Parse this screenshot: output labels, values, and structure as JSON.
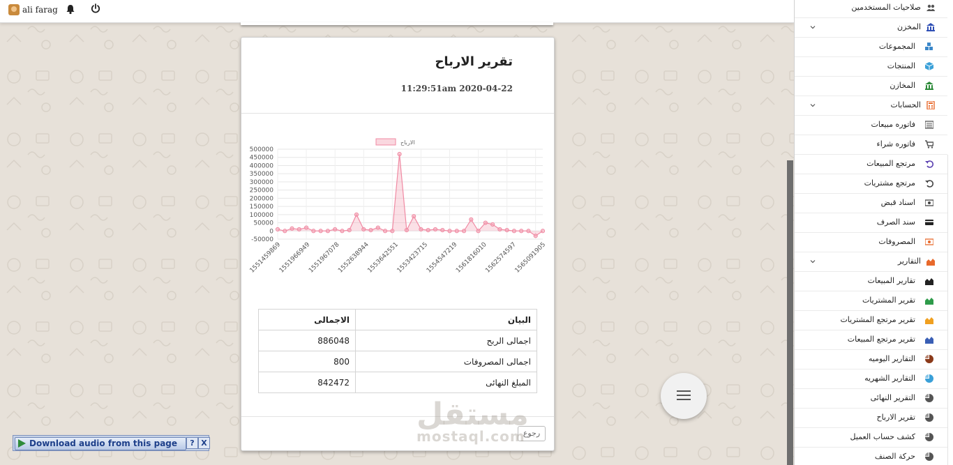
{
  "topbar": {
    "user_name": "ali farag",
    "icons": [
      "avatar-icon",
      "bell-icon",
      "power-icon"
    ]
  },
  "report": {
    "title": "تقرير الارباح",
    "datetime": "11:29:51am 2020-04-22",
    "back_label": "رجوع"
  },
  "chart_data": {
    "type": "area",
    "legend": [
      "الارباح"
    ],
    "series": [
      {
        "name": "الارباح",
        "color": "#f4a6b8",
        "values": [
          10000,
          0,
          15000,
          10000,
          20000,
          0,
          0,
          0,
          10000,
          0,
          5000,
          100000,
          10000,
          5000,
          20000,
          0,
          0,
          470000,
          5000,
          90000,
          10000,
          5000,
          10000,
          5000,
          0,
          0,
          0,
          70000,
          0,
          50000,
          40000,
          10000,
          5000,
          0,
          0,
          0,
          -30000,
          0
        ]
      }
    ],
    "x_tick_labels": [
      "1551459869",
      "1551966949",
      "1551967078",
      "1552638944",
      "1553642551",
      "1553423715",
      "1554547219",
      "1561816010",
      "1562574597",
      "1565091905"
    ],
    "ylim": [
      -50000,
      500000
    ],
    "y_ticks": [
      500000,
      450000,
      400000,
      350000,
      300000,
      250000,
      200000,
      150000,
      100000,
      50000,
      0,
      -50000
    ],
    "grid": true,
    "legend_position": "top"
  },
  "summary": {
    "headers": {
      "label": "البيان",
      "value": "الاجمالى"
    },
    "rows": [
      {
        "label": "اجمالى الربح",
        "value": "886048"
      },
      {
        "label": "اجمالى المصروفات",
        "value": "800"
      },
      {
        "label": "المبلغ النهائى",
        "value": "842472"
      }
    ]
  },
  "watermark": {
    "ar": "مستقل",
    "en": "mostaql.com"
  },
  "sidebar": {
    "items": [
      {
        "label": "صلاحيات المستخدمين",
        "icon": "users-icon",
        "color": "#555"
      },
      {
        "label": "المخزن",
        "icon": "bank-icon",
        "color": "#2f4fb5",
        "expandable": true
      },
      {
        "label": "المجموعات",
        "icon": "cubes-icon",
        "color": "#3a87c9",
        "sub": true
      },
      {
        "label": "المنتجات",
        "icon": "cube-icon",
        "color": "#3aa0d8",
        "sub": true
      },
      {
        "label": "المخازن",
        "icon": "warehouse-icon",
        "color": "#2e8b3a",
        "sub": true
      },
      {
        "label": "الحسابات",
        "icon": "calculator-icon",
        "color": "#e8692b",
        "expandable": true
      },
      {
        "label": "فاتوره مبيعات",
        "icon": "list-alt-icon",
        "color": "#555",
        "sub": true
      },
      {
        "label": "فاتوره شراء",
        "icon": "cart-icon",
        "color": "#555",
        "sub": true
      },
      {
        "label": "مرتجع المبيعات",
        "icon": "undo-icon",
        "color": "#5a3fb0",
        "sub": true
      },
      {
        "label": "مرتجع مشتريات",
        "icon": "undo-icon",
        "color": "#444",
        "sub": true
      },
      {
        "label": "اسناد قبض",
        "icon": "money-icon",
        "color": "#444",
        "sub": true
      },
      {
        "label": "سند الصرف",
        "icon": "credit-card-icon",
        "color": "#222",
        "sub": true
      },
      {
        "label": "المصروفات",
        "icon": "money-icon",
        "color": "#e8692b",
        "sub": true
      },
      {
        "label": "التقارير",
        "icon": "area-chart-icon",
        "color": "#e8692b",
        "expandable": true
      },
      {
        "label": "تقارير المبيعات",
        "icon": "area-chart-icon",
        "color": "#222",
        "sub": true
      },
      {
        "label": "تقرير المشتريات",
        "icon": "area-chart-icon",
        "color": "#2e9b4a",
        "sub": true
      },
      {
        "label": "تقرير مرتجع المشتريات",
        "icon": "area-chart-icon",
        "color": "#f0a020",
        "sub": true
      },
      {
        "label": "تقرير مرتجع المبيعات",
        "icon": "area-chart-icon",
        "color": "#3a5fb5",
        "sub": true
      },
      {
        "label": "التقارير اليوميه",
        "icon": "pie-chart-icon",
        "color": "#8b3a1a",
        "sub": true
      },
      {
        "label": "التقارير الشهريه",
        "icon": "pie-chart-icon",
        "color": "#3aa0d8",
        "sub": true
      },
      {
        "label": "التقرير النهائى",
        "icon": "pie-chart-icon",
        "color": "#555",
        "sub": true
      },
      {
        "label": "تقرير الارباح",
        "icon": "pie-chart-icon",
        "color": "#555",
        "sub": true
      },
      {
        "label": "كشف حساب العميل",
        "icon": "pie-chart-icon",
        "color": "#555",
        "sub": true
      },
      {
        "label": "حركة الصنف",
        "icon": "pie-chart-icon",
        "color": "#555",
        "sub": true
      }
    ]
  },
  "download_bar": {
    "label": "Download audio from this page",
    "help": "?",
    "close": "X"
  }
}
